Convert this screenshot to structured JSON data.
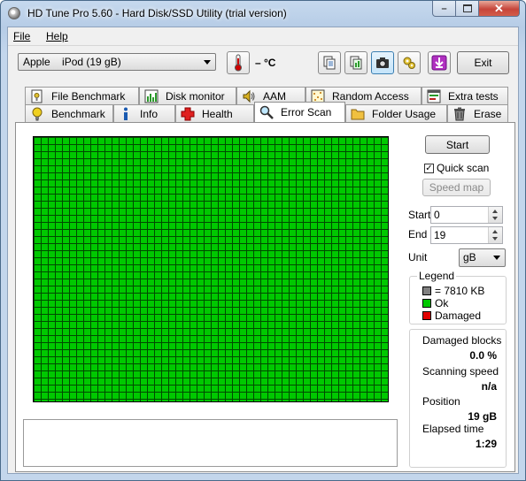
{
  "window": {
    "title": "HD Tune Pro 5.60 - Hard Disk/SSD Utility (trial version)"
  },
  "menu": {
    "file": "File",
    "help": "Help"
  },
  "toolbar": {
    "drive": "Apple    iPod (19 gB)",
    "temperature": "– °C",
    "exit_label": "Exit",
    "icons": [
      "copy-info-icon",
      "copy-report-icon",
      "screenshot-icon",
      "options-icon",
      "save-icon"
    ]
  },
  "tabs_top": [
    "File Benchmark",
    "Disk monitor",
    "AAM",
    "Random Access",
    "Extra tests"
  ],
  "tabs_bottom": [
    "Benchmark",
    "Info",
    "Health",
    "Error Scan",
    "Folder Usage",
    "Erase"
  ],
  "selected_tab": "Error Scan",
  "scan": {
    "start_button": "Start",
    "quick_scan_label": "Quick scan",
    "quick_scan_checked": true,
    "speed_map_button": "Speed map",
    "start_label": "Start",
    "start_value": "0",
    "end_label": "End",
    "end_value": "19",
    "unit_label": "Unit",
    "unit_value": "gB",
    "grid_color": "#00c800"
  },
  "legend": {
    "title": "Legend",
    "items": [
      {
        "label": "= 7810 KB",
        "color": "#808080"
      },
      {
        "label": "Ok",
        "color": "#00c800"
      },
      {
        "label": "Damaged",
        "color": "#e00000"
      }
    ]
  },
  "stats": {
    "damaged_blocks_label": "Damaged blocks",
    "damaged_blocks_value": "0.0 %",
    "scanning_speed_label": "Scanning speed",
    "scanning_speed_value": "n/a",
    "position_label": "Position",
    "position_value": "19 gB",
    "elapsed_label": "Elapsed time",
    "elapsed_value": "1:29"
  }
}
